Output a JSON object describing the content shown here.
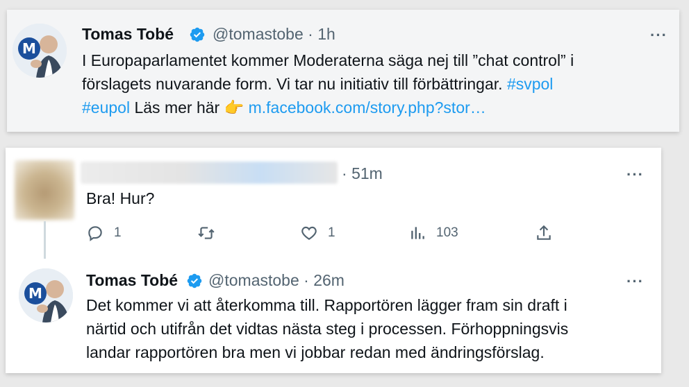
{
  "tweet": {
    "author_name": "Tomas Tobé",
    "handle": "@tomastobe",
    "separator": "·",
    "time": "1h",
    "text_line1": "I Europaparlamentet kommer Moderaterna säga nej till ”chat control” i",
    "text_line2_pre": "förslagets nuvarande form. Vi tar nu initiativ till förbättringar. ",
    "hashtag1": "#svpol",
    "hashtag2": "#eupol",
    "text_line3_mid": " Läs mer här ",
    "pointing_emoji": "👉",
    "link": "m.facebook.com/story.php?stor…",
    "more": "···"
  },
  "reply": {
    "separator": "·",
    "time": "51m",
    "text": "Bra! Hur?",
    "more": "···",
    "actions": {
      "replies": "1",
      "retweets": "",
      "likes": "1",
      "views": "103"
    }
  },
  "response": {
    "author_name": "Tomas Tobé",
    "handle": "@tomastobe",
    "separator": "·",
    "time": "26m",
    "more": "···",
    "line1": "Det kommer vi att återkomma till. Rapportören lägger fram sin draft i",
    "line2": "närtid och utifrån det vidtas nästa steg i processen. Förhoppningsvis",
    "line3": "landar rapportören bra men vi jobbar redan med ändringsförslag."
  },
  "colors": {
    "accent": "#1d9bf0",
    "secondary_text": "#536471",
    "moderaterna_blue": "#1b4f9c"
  },
  "icons": [
    "verified-badge-icon",
    "more-icon",
    "reply-icon",
    "retweet-icon",
    "like-icon",
    "views-icon",
    "share-icon",
    "pointing-hand-emoji"
  ]
}
